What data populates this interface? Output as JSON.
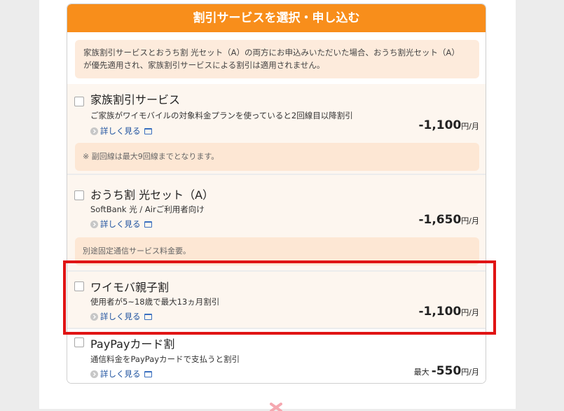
{
  "header": {
    "title": "割引サービスを選択・申し込む"
  },
  "notice": {
    "line1": "家族割引サービスとおうち割 光セット（A）の両方にお申込みいただいた場合、おうち割光セット（A）",
    "line2": "が優先適用され、家族割引サービスによる割引は適用されません。"
  },
  "detail_label": "詳しく見る",
  "services": [
    {
      "title": "家族割引サービス",
      "desc": "ご家族がワイモバイルの対象料金プランを使っていると2回線目以降割引",
      "amount": "-1,100",
      "unit": "円/月",
      "note": "※ 副回線は最大9回線までとなります。"
    },
    {
      "title": "おうち割 光セット（A）",
      "desc": "SoftBank 光 / Airご利用者向け",
      "amount": "-1,650",
      "unit": "円/月",
      "note": "別途固定通信サービス料金要。"
    },
    {
      "title": "ワイモバ親子割",
      "desc": "使用者が5~18歳で最大13ヵ月割引",
      "amount": "-1,100",
      "unit": "円/月"
    },
    {
      "title": "PayPayカード割",
      "desc": "通信料金をPayPayカードで支払うと割引",
      "prefix": "最大",
      "amount": "-550",
      "unit": "円/月"
    }
  ],
  "colors": {
    "header_bg": "#f88e1b",
    "highlight": "#e01414",
    "link": "#1a4f9e"
  }
}
